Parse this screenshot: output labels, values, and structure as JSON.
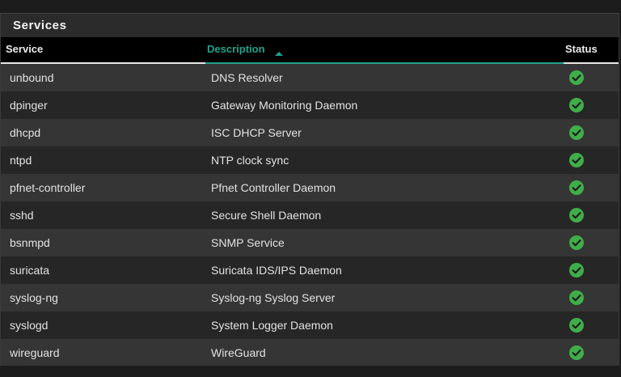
{
  "panel": {
    "title": "Services"
  },
  "table": {
    "columns": {
      "service": "Service",
      "description": "Description",
      "status": "Status"
    },
    "sort": {
      "column": "description",
      "direction": "ascending"
    },
    "rows": [
      {
        "service": "unbound",
        "description": "DNS Resolver",
        "status": "running"
      },
      {
        "service": "dpinger",
        "description": "Gateway Monitoring Daemon",
        "status": "running"
      },
      {
        "service": "dhcpd",
        "description": "ISC DHCP Server",
        "status": "running"
      },
      {
        "service": "ntpd",
        "description": "NTP clock sync",
        "status": "running"
      },
      {
        "service": "pfnet-controller",
        "description": "Pfnet Controller Daemon",
        "status": "running"
      },
      {
        "service": "sshd",
        "description": "Secure Shell Daemon",
        "status": "running"
      },
      {
        "service": "bsnmpd",
        "description": "SNMP Service",
        "status": "running"
      },
      {
        "service": "suricata",
        "description": "Suricata IDS/IPS Daemon",
        "status": "running"
      },
      {
        "service": "syslog-ng",
        "description": "Syslog-ng Syslog Server",
        "status": "running"
      },
      {
        "service": "syslogd",
        "description": "System Logger Daemon",
        "status": "running"
      },
      {
        "service": "wireguard",
        "description": "WireGuard",
        "status": "running"
      }
    ]
  },
  "colors": {
    "accent": "#1fa38c",
    "status_ok": "#3fae49",
    "row_odd": "#353535",
    "row_even": "#262626"
  },
  "icons": {
    "status": "check-circle-icon",
    "sort": "sort-ascending-icon"
  }
}
